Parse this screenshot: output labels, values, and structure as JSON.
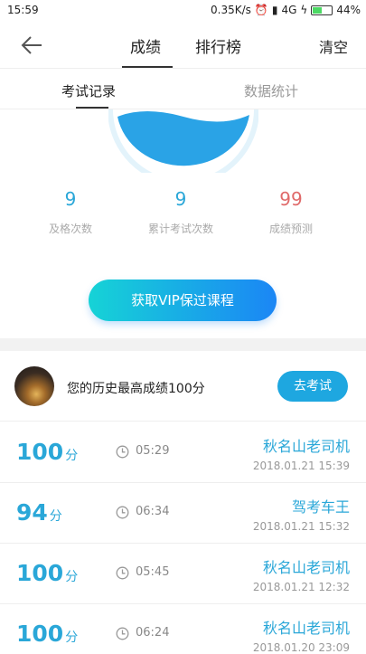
{
  "status": {
    "time": "15:59",
    "speed": "0.35K/s",
    "network": "4G",
    "battery": "44%"
  },
  "nav": {
    "tab1": "成绩",
    "tab2": "排行榜",
    "clear": "清空"
  },
  "subtabs": {
    "tab1": "考试记录",
    "tab2": "数据统计"
  },
  "stats": {
    "pass_count": "9",
    "pass_label": "及格次数",
    "total_count": "9",
    "total_label": "累计考试次数",
    "predict": "99",
    "predict_label": "成绩预测"
  },
  "vip_button": "获取VIP保过课程",
  "best": {
    "text": "您的历史最高成绩100分",
    "button": "去考试"
  },
  "records": [
    {
      "score": "100",
      "unit": "分",
      "duration": "05:29",
      "name": "秋名山老司机",
      "date": "2018.01.21  15:39"
    },
    {
      "score": "94",
      "unit": "分",
      "duration": "06:34",
      "name": "驾考车王",
      "date": "2018.01.21  15:32"
    },
    {
      "score": "100",
      "unit": "分",
      "duration": "05:45",
      "name": "秋名山老司机",
      "date": "2018.01.21  12:32"
    },
    {
      "score": "100",
      "unit": "分",
      "duration": "06:24",
      "name": "秋名山老司机",
      "date": "2018.01.20  23:09"
    }
  ],
  "colors": {
    "accent": "#2aa7d8",
    "predict": "#e06a6a",
    "gauge_fill": "#2aa3e6"
  }
}
